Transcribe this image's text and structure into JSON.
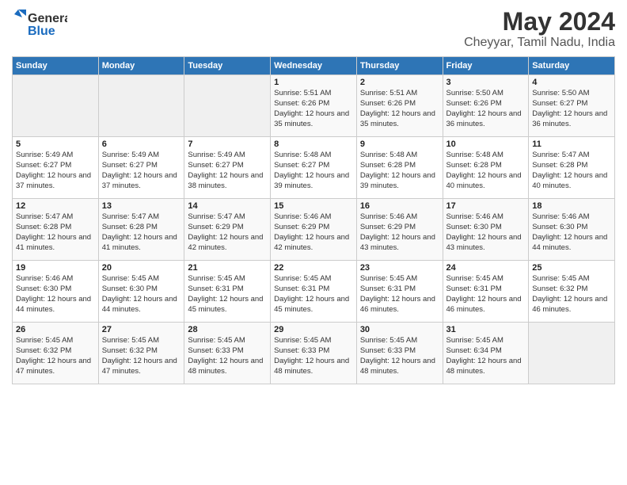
{
  "header": {
    "title": "May 2024",
    "subtitle": "Cheyyar, Tamil Nadu, India"
  },
  "weekdays": [
    "Sunday",
    "Monday",
    "Tuesday",
    "Wednesday",
    "Thursday",
    "Friday",
    "Saturday"
  ],
  "weeks": [
    [
      {
        "day": "",
        "info": ""
      },
      {
        "day": "",
        "info": ""
      },
      {
        "day": "",
        "info": ""
      },
      {
        "day": "1",
        "info": "Sunrise: 5:51 AM\nSunset: 6:26 PM\nDaylight: 12 hours\nand 35 minutes."
      },
      {
        "day": "2",
        "info": "Sunrise: 5:51 AM\nSunset: 6:26 PM\nDaylight: 12 hours\nand 35 minutes."
      },
      {
        "day": "3",
        "info": "Sunrise: 5:50 AM\nSunset: 6:26 PM\nDaylight: 12 hours\nand 36 minutes."
      },
      {
        "day": "4",
        "info": "Sunrise: 5:50 AM\nSunset: 6:27 PM\nDaylight: 12 hours\nand 36 minutes."
      }
    ],
    [
      {
        "day": "5",
        "info": "Sunrise: 5:49 AM\nSunset: 6:27 PM\nDaylight: 12 hours\nand 37 minutes."
      },
      {
        "day": "6",
        "info": "Sunrise: 5:49 AM\nSunset: 6:27 PM\nDaylight: 12 hours\nand 37 minutes."
      },
      {
        "day": "7",
        "info": "Sunrise: 5:49 AM\nSunset: 6:27 PM\nDaylight: 12 hours\nand 38 minutes."
      },
      {
        "day": "8",
        "info": "Sunrise: 5:48 AM\nSunset: 6:27 PM\nDaylight: 12 hours\nand 39 minutes."
      },
      {
        "day": "9",
        "info": "Sunrise: 5:48 AM\nSunset: 6:28 PM\nDaylight: 12 hours\nand 39 minutes."
      },
      {
        "day": "10",
        "info": "Sunrise: 5:48 AM\nSunset: 6:28 PM\nDaylight: 12 hours\nand 40 minutes."
      },
      {
        "day": "11",
        "info": "Sunrise: 5:47 AM\nSunset: 6:28 PM\nDaylight: 12 hours\nand 40 minutes."
      }
    ],
    [
      {
        "day": "12",
        "info": "Sunrise: 5:47 AM\nSunset: 6:28 PM\nDaylight: 12 hours\nand 41 minutes."
      },
      {
        "day": "13",
        "info": "Sunrise: 5:47 AM\nSunset: 6:28 PM\nDaylight: 12 hours\nand 41 minutes."
      },
      {
        "day": "14",
        "info": "Sunrise: 5:47 AM\nSunset: 6:29 PM\nDaylight: 12 hours\nand 42 minutes."
      },
      {
        "day": "15",
        "info": "Sunrise: 5:46 AM\nSunset: 6:29 PM\nDaylight: 12 hours\nand 42 minutes."
      },
      {
        "day": "16",
        "info": "Sunrise: 5:46 AM\nSunset: 6:29 PM\nDaylight: 12 hours\nand 43 minutes."
      },
      {
        "day": "17",
        "info": "Sunrise: 5:46 AM\nSunset: 6:30 PM\nDaylight: 12 hours\nand 43 minutes."
      },
      {
        "day": "18",
        "info": "Sunrise: 5:46 AM\nSunset: 6:30 PM\nDaylight: 12 hours\nand 44 minutes."
      }
    ],
    [
      {
        "day": "19",
        "info": "Sunrise: 5:46 AM\nSunset: 6:30 PM\nDaylight: 12 hours\nand 44 minutes."
      },
      {
        "day": "20",
        "info": "Sunrise: 5:45 AM\nSunset: 6:30 PM\nDaylight: 12 hours\nand 44 minutes."
      },
      {
        "day": "21",
        "info": "Sunrise: 5:45 AM\nSunset: 6:31 PM\nDaylight: 12 hours\nand 45 minutes."
      },
      {
        "day": "22",
        "info": "Sunrise: 5:45 AM\nSunset: 6:31 PM\nDaylight: 12 hours\nand 45 minutes."
      },
      {
        "day": "23",
        "info": "Sunrise: 5:45 AM\nSunset: 6:31 PM\nDaylight: 12 hours\nand 46 minutes."
      },
      {
        "day": "24",
        "info": "Sunrise: 5:45 AM\nSunset: 6:31 PM\nDaylight: 12 hours\nand 46 minutes."
      },
      {
        "day": "25",
        "info": "Sunrise: 5:45 AM\nSunset: 6:32 PM\nDaylight: 12 hours\nand 46 minutes."
      }
    ],
    [
      {
        "day": "26",
        "info": "Sunrise: 5:45 AM\nSunset: 6:32 PM\nDaylight: 12 hours\nand 47 minutes."
      },
      {
        "day": "27",
        "info": "Sunrise: 5:45 AM\nSunset: 6:32 PM\nDaylight: 12 hours\nand 47 minutes."
      },
      {
        "day": "28",
        "info": "Sunrise: 5:45 AM\nSunset: 6:33 PM\nDaylight: 12 hours\nand 48 minutes."
      },
      {
        "day": "29",
        "info": "Sunrise: 5:45 AM\nSunset: 6:33 PM\nDaylight: 12 hours\nand 48 minutes."
      },
      {
        "day": "30",
        "info": "Sunrise: 5:45 AM\nSunset: 6:33 PM\nDaylight: 12 hours\nand 48 minutes."
      },
      {
        "day": "31",
        "info": "Sunrise: 5:45 AM\nSunset: 6:34 PM\nDaylight: 12 hours\nand 48 minutes."
      },
      {
        "day": "",
        "info": ""
      }
    ]
  ]
}
